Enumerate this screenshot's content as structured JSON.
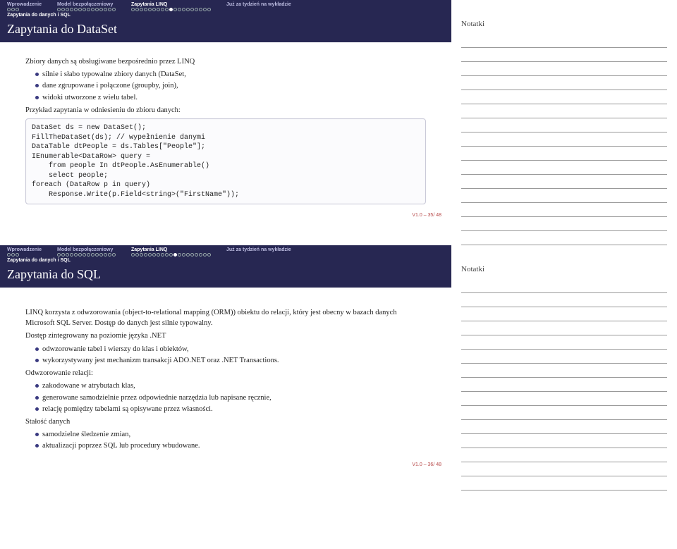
{
  "header": {
    "sections": [
      {
        "label": "Wprowadzenie",
        "dots": 3,
        "filled": -1
      },
      {
        "label": "Model bezpołączeniowy",
        "dots": 14,
        "filled": -1
      },
      {
        "label": "Zapytania LINQ",
        "dots": 19,
        "filled": 9,
        "active": true
      },
      {
        "label": "Już za tydzień na wykładzie",
        "dots": 0,
        "filled": -1
      }
    ],
    "subsection": "Zapytania do danych i SQL"
  },
  "slide1": {
    "title": "Zapytania do DataSet",
    "lead": "Zbiory danych są obsługiwane bezpośrednio przez LINQ",
    "bullets": [
      "silnie i słabo typowalne zbiory danych (DataSet,",
      "dane zgrupowane i połączone (groupby, join),",
      "widoki utworzone z wielu tabel."
    ],
    "para": "Przykład zapytania w odniesieniu do zbioru danych:",
    "code": "DataSet ds = new DataSet();\nFillTheDataSet(ds); // wypełnienie danymi\nDataTable dtPeople = ds.Tables[\"People\"];\nIEnumerable<DataRow> query =\n    from people In dtPeople.AsEnumerable()\n    select people;\nforeach (DataRow p in query)\n    Response.Write(p.Field<string>(\"FirstName\"));",
    "footer": "V1.0 – 35/ 48"
  },
  "header2_filled": 10,
  "slide2": {
    "title": "Zapytania do SQL",
    "p1": "LINQ korzysta z odwzorowania (object-to-relational mapping (ORM)) obiektu do relacji, który jest obecny w bazach danych Microsoft SQL Server. Dostęp do danych jest silnie typowalny.",
    "p2": "Dostęp zintegrowany na poziomie języka .NET",
    "b1": [
      "odwzorowanie tabel i wierszy do klas i obiektów,",
      "wykorzystywany jest mechanizm transakcji ADO.NET oraz .NET Transactions."
    ],
    "p3": "Odwzorowanie relacji:",
    "b2": [
      "zakodowane w atrybutach klas,",
      "generowane samodzielnie przez odpowiednie narzędzia lub napisane ręcznie,",
      "relację pomiędzy tabelami są opisywane przez własności."
    ],
    "p4": "Stałość danych",
    "b3": [
      "samodzielne śledzenie zmian,",
      "aktualizacji poprzez SQL lub procedury wbudowane."
    ],
    "footer": "V1.0 – 36/ 48"
  },
  "notes_label": "Notatki"
}
